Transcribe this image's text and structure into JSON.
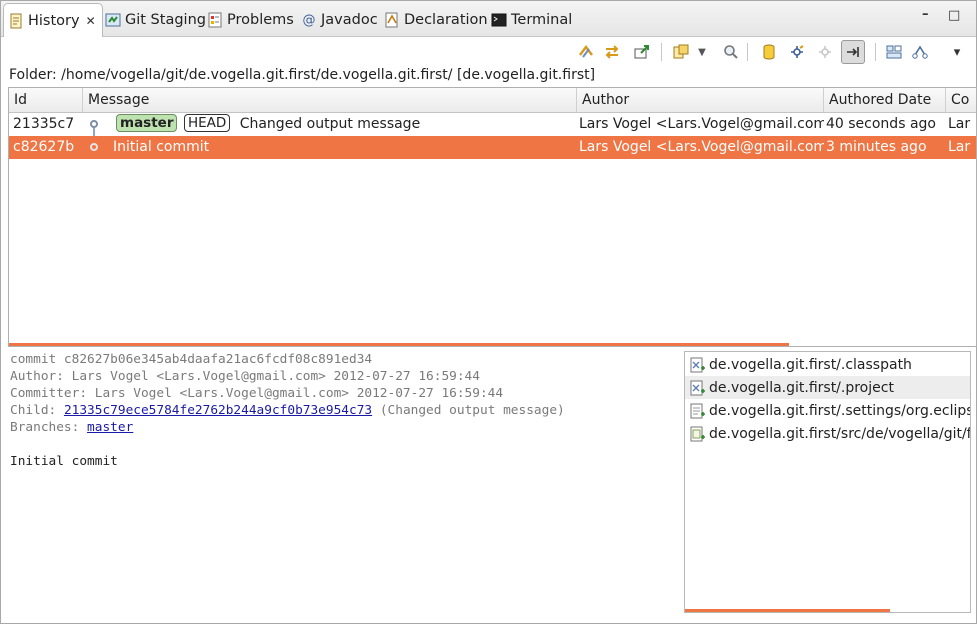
{
  "tabs": [
    {
      "label": "History",
      "icon": "history-icon",
      "active": true
    },
    {
      "label": "Git Staging",
      "icon": "git-staging-icon"
    },
    {
      "label": "Problems",
      "icon": "problems-icon"
    },
    {
      "label": "Javadoc",
      "icon": "javadoc-icon"
    },
    {
      "label": "Declaration",
      "icon": "declaration-icon"
    },
    {
      "label": "Terminal",
      "icon": "terminal-icon"
    }
  ],
  "tab_close_glyph": "✕",
  "window": {
    "minimize_glyph": "–",
    "maximize_glyph": "□",
    "menu_glyph": "▾"
  },
  "folder_text": "Folder: /home/vogella/git/de.vogella.git.first/de.vogella.git.first/ [de.vogella.git.first]",
  "table": {
    "headers": [
      "Id",
      "Message",
      "Author",
      "Authored Date",
      "Co"
    ],
    "rows": [
      {
        "id": "21335c7",
        "branch": "master",
        "head": "HEAD",
        "message": "Changed output message",
        "author": "Lars Vogel <Lars.Vogel@gmail.com>",
        "date": "40 seconds ago",
        "committer": "Lar"
      },
      {
        "id": "c82627b",
        "message": "Initial commit",
        "author": "Lars Vogel <Lars.Vogel@gmail.com>",
        "date": "3 minutes ago",
        "committer": "Lar",
        "selected": true
      }
    ]
  },
  "details": {
    "commit": "commit c82627b06e345ab4daafa21ac6fcdf08c891ed34",
    "author": "Author: Lars Vogel <Lars.Vogel@gmail.com> 2012-07-27 16:59:44",
    "committer": "Committer: Lars Vogel <Lars.Vogel@gmail.com> 2012-07-27 16:59:44",
    "child_label": "Child: ",
    "child_hash": "21335c79ece5784fe2762b244a9cf0b73e954c73",
    "child_msg": " (Changed output message)",
    "branches_label": "Branches: ",
    "branch": "master",
    "message": "Initial commit"
  },
  "files": [
    "de.vogella.git.first/.classpath",
    "de.vogella.git.first/.project",
    "de.vogella.git.first/.settings/org.eclipse",
    "de.vogella.git.first/src/de/vogella/git/fi"
  ],
  "colors": {
    "selection": "#f07545",
    "branch_badge": "#bfe3b0",
    "link": "#1a1aa6"
  }
}
